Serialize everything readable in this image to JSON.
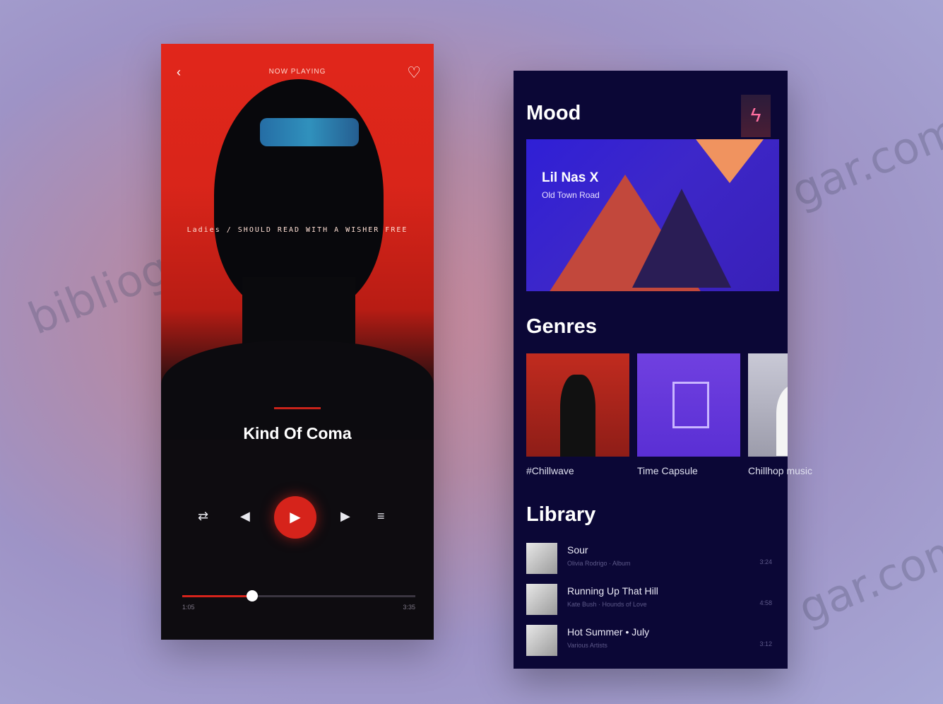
{
  "player": {
    "back_icon": "‹",
    "now_playing_label": "NOW PLAYING",
    "like_icon": "♡",
    "lyric": "Ladies / SHOULD READ WITH A WISHER FREE",
    "track_title": "Kind Of Coma",
    "progress": 0.3,
    "time_elapsed": "1:05",
    "time_total": "3:35",
    "controls": {
      "repeat_icon": "⇄",
      "prev_icon": "◀",
      "play_icon": "▶",
      "next_icon": "▶",
      "queue_icon": "≡"
    },
    "accent_color": "#d6231b"
  },
  "browse": {
    "mood_heading": "Mood",
    "profile_icon": "ϟ",
    "featured": {
      "artist": "Lil Nas X",
      "album": "Old Town Road"
    },
    "genres_heading": "Genres",
    "genres": [
      {
        "label": "#Chillwave"
      },
      {
        "label": "Time Capsule"
      },
      {
        "label": "Chillhop music"
      }
    ],
    "library_heading": "Library",
    "library": [
      {
        "title": "Sour",
        "subtitle": "Olivia Rodrigo · Album",
        "duration": "3:24"
      },
      {
        "title": "Running Up That Hill",
        "subtitle": "Kate Bush · Hounds of Love",
        "duration": "4:58"
      },
      {
        "title": "Hot Summer • July",
        "subtitle": "Various Artists",
        "duration": "3:12"
      }
    ],
    "background_color": "#0b0736"
  },
  "watermark": {
    "left_text": "bibliography",
    "right_text": "gar.com"
  }
}
